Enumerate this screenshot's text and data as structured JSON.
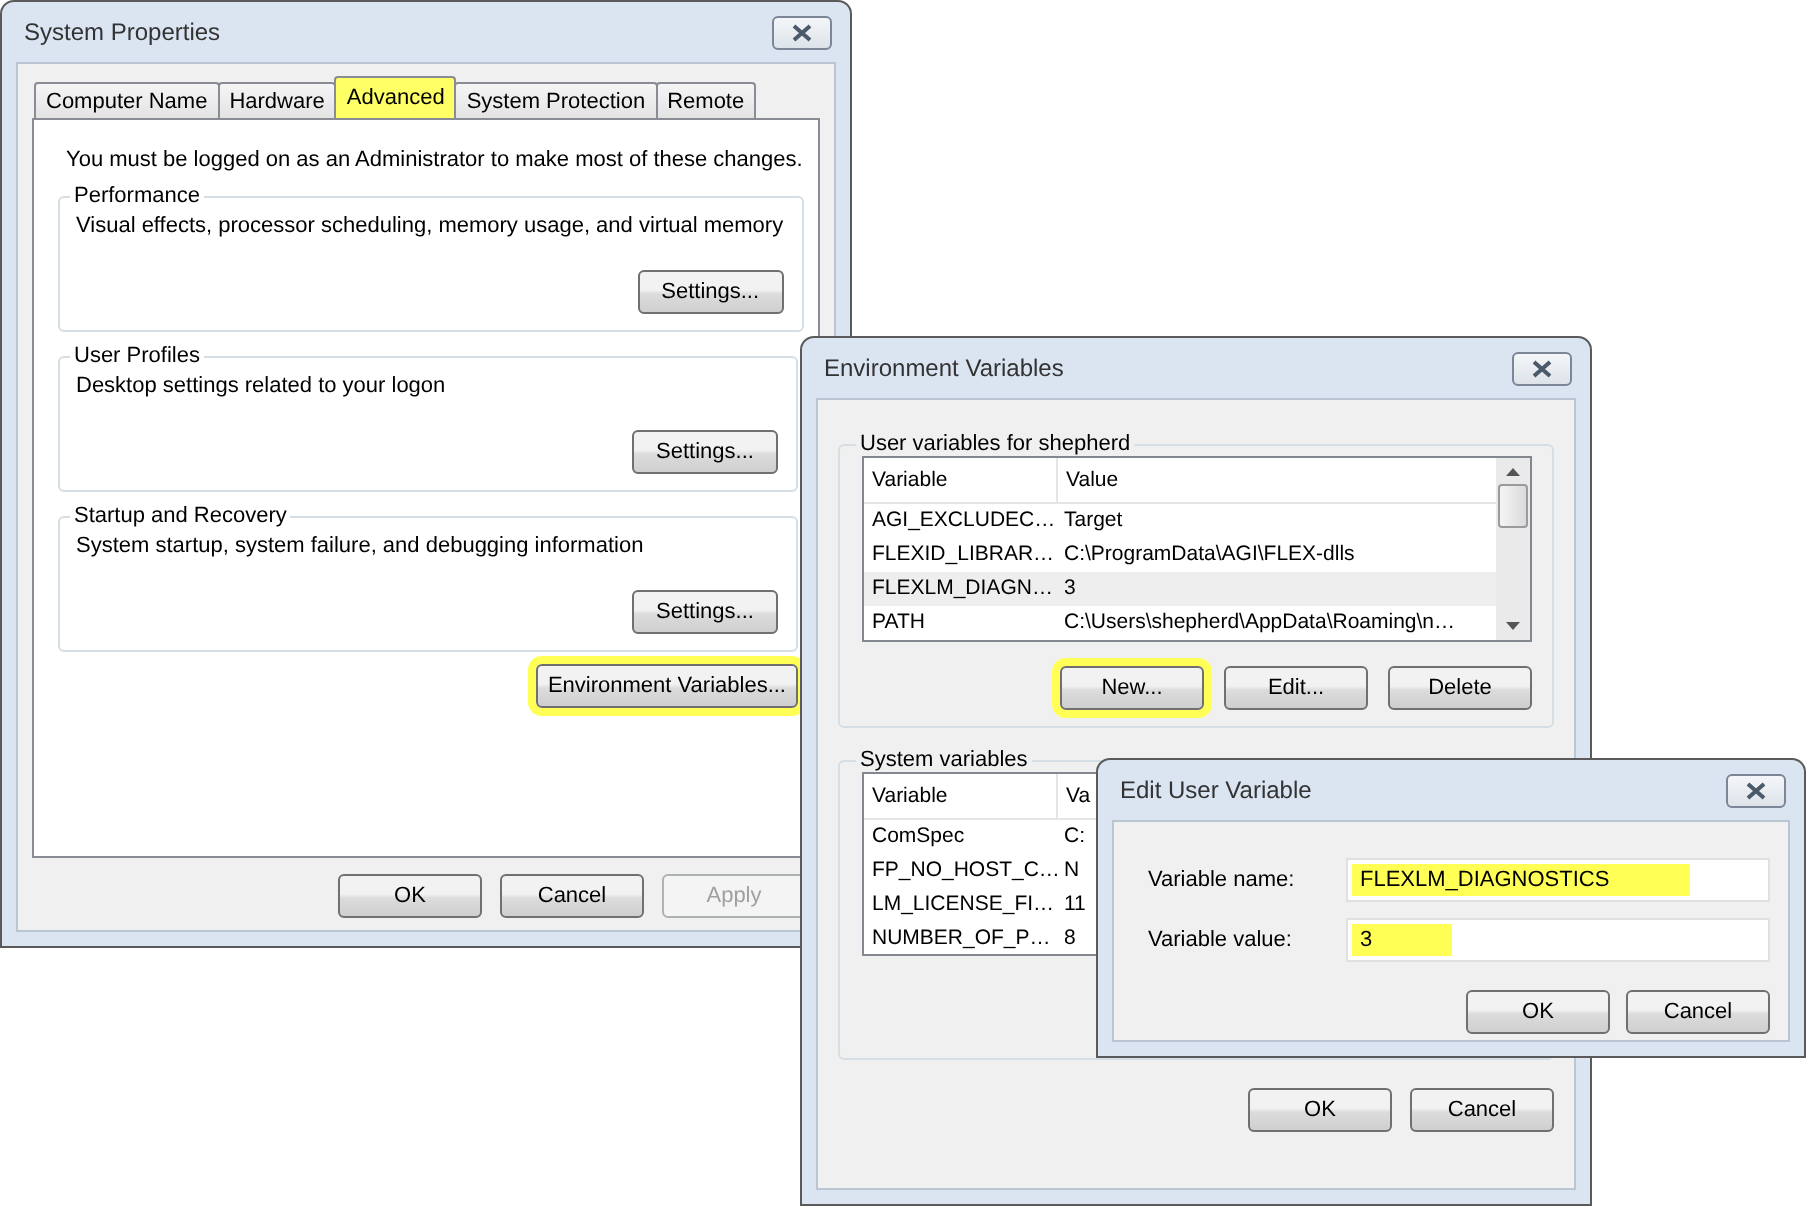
{
  "system_properties": {
    "title": "System Properties",
    "tabs": [
      {
        "label": "Computer Name",
        "selected": false,
        "highlighted": false
      },
      {
        "label": "Hardware",
        "selected": false,
        "highlighted": false
      },
      {
        "label": "Advanced",
        "selected": true,
        "highlighted": true
      },
      {
        "label": "System Protection",
        "selected": false,
        "highlighted": false
      },
      {
        "label": "Remote",
        "selected": false,
        "highlighted": false
      }
    ],
    "notice": "You must be logged on as an Administrator to make most of these changes.",
    "groups": [
      {
        "legend": "Performance",
        "description": "Visual effects, processor scheduling, memory usage, and virtual memory",
        "button": "Settings..."
      },
      {
        "legend": "User Profiles",
        "description": "Desktop settings related to your logon",
        "button": "Settings..."
      },
      {
        "legend": "Startup and Recovery",
        "description": "System startup, system failure, and debugging information",
        "button": "Settings..."
      }
    ],
    "env_button": {
      "label": "Environment Variables...",
      "highlighted": true
    },
    "buttons": [
      {
        "label": "OK",
        "disabled": false
      },
      {
        "label": "Cancel",
        "disabled": false
      },
      {
        "label": "Apply",
        "disabled": true
      }
    ]
  },
  "environment_variables": {
    "title": "Environment Variables",
    "user_variables": {
      "legend": "User variables for shepherd",
      "columns": [
        "Variable",
        "Value"
      ],
      "rows": [
        {
          "cells": [
            "AGI_EXCLUDEC…",
            "Target"
          ],
          "selected": false
        },
        {
          "cells": [
            "FLEXID_LIBRAR…",
            "C:\\ProgramData\\AGI\\FLEX-dlls"
          ],
          "selected": false
        },
        {
          "cells": [
            "FLEXLM_DIAGN…",
            "3"
          ],
          "selected": true
        },
        {
          "cells": [
            "PATH",
            "C:\\Users\\shepherd\\AppData\\Roaming\\n…"
          ],
          "selected": false
        }
      ],
      "buttons": [
        {
          "label": "New...",
          "highlighted": true
        },
        {
          "label": "Edit...",
          "highlighted": false
        },
        {
          "label": "Delete",
          "highlighted": false
        }
      ]
    },
    "system_variables": {
      "legend": "System variables",
      "columns": [
        "Variable",
        "Va"
      ],
      "rows": [
        {
          "cells": [
            "ComSpec",
            "C:"
          ],
          "selected": false
        },
        {
          "cells": [
            "FP_NO_HOST_C…",
            "N"
          ],
          "selected": false
        },
        {
          "cells": [
            "LM_LICENSE_FI…",
            "11"
          ],
          "selected": false
        },
        {
          "cells": [
            "NUMBER_OF_P…",
            "8"
          ],
          "selected": false
        }
      ]
    },
    "buttons": [
      {
        "label": "OK"
      },
      {
        "label": "Cancel"
      }
    ]
  },
  "edit_user_variable": {
    "title": "Edit User Variable",
    "fields": [
      {
        "label": "Variable name:",
        "value": "FLEXLM_DIAGNOSTICS",
        "highlighted": true
      },
      {
        "label": "Variable value:",
        "value": "3",
        "highlighted": true
      }
    ],
    "buttons": [
      {
        "label": "OK"
      },
      {
        "label": "Cancel"
      }
    ]
  }
}
